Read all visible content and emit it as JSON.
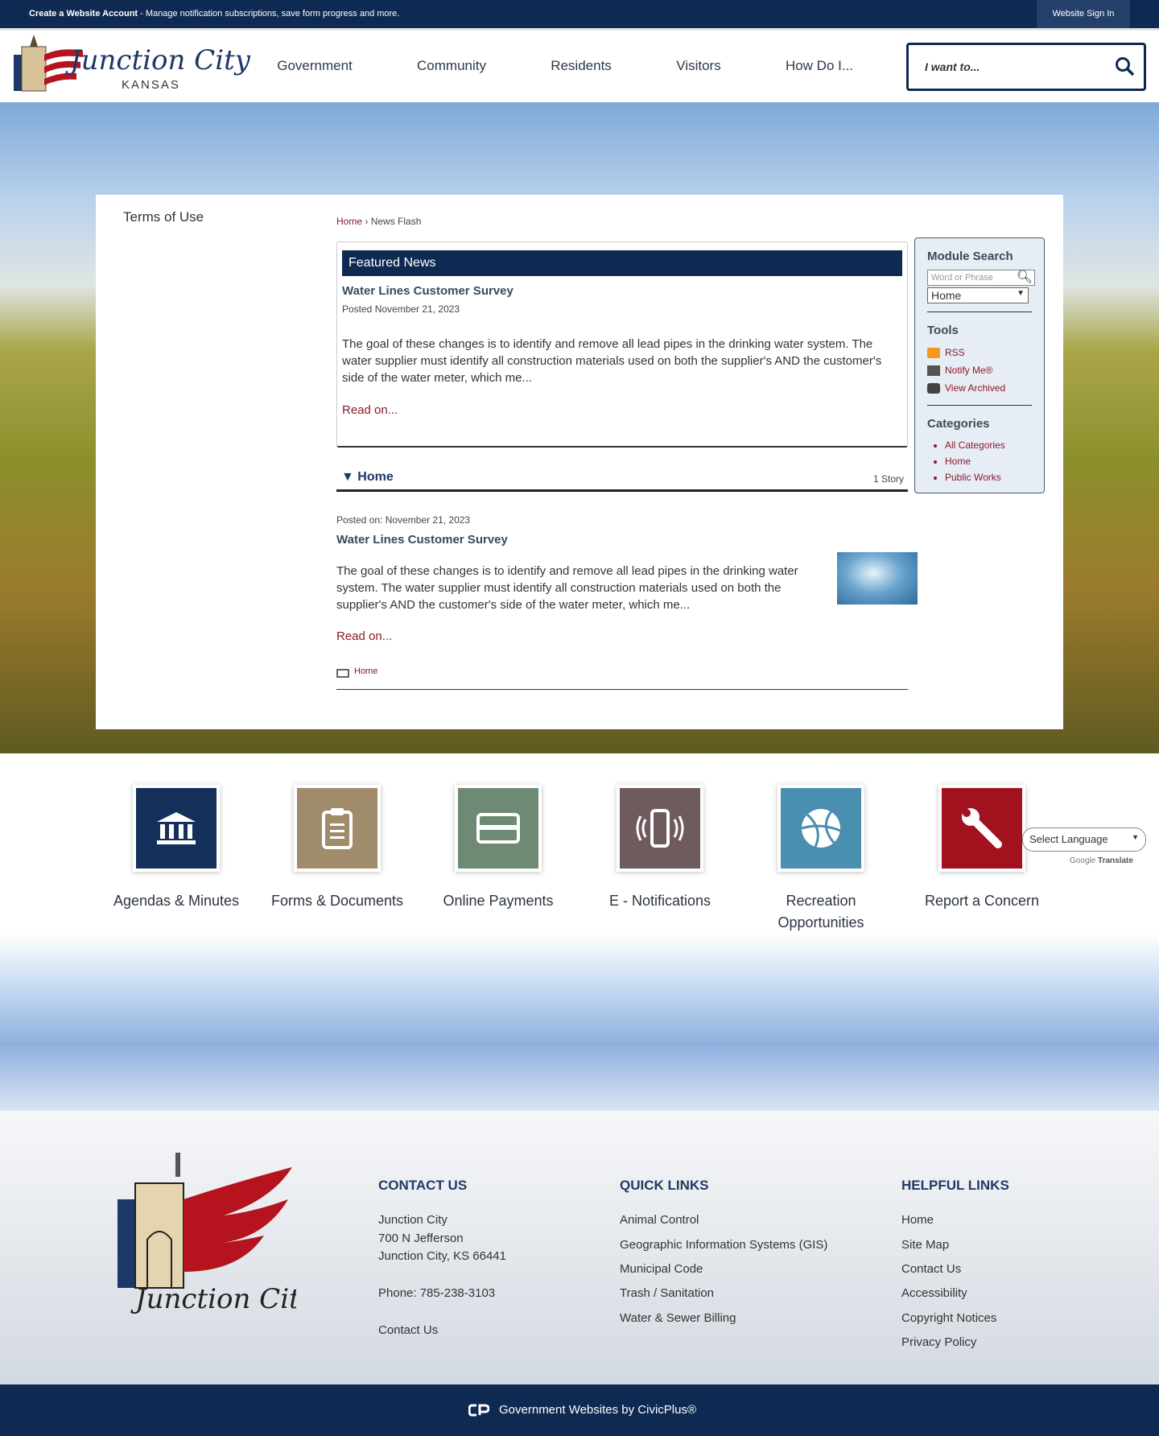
{
  "topbar": {
    "create_account": "Create a Website Account",
    "message": " - Manage notification subscriptions, save form progress and more.",
    "sign_in": "Website Sign In"
  },
  "logo": {
    "name": "Junction City",
    "state": "KANSAS"
  },
  "nav": [
    "Government",
    "Community",
    "Residents",
    "Visitors",
    "How Do I..."
  ],
  "search": {
    "placeholder": "I want to..."
  },
  "left": {
    "terms": "Terms of Use"
  },
  "breadcrumb": {
    "home": "Home",
    "sep": "›",
    "current": "News Flash"
  },
  "featured": {
    "header": "Featured News",
    "title": "Water Lines Customer Survey",
    "posted": "Posted November 21, 2023",
    "body": "The goal of these changes is to identify and remove all lead pipes in the drinking water system. The water supplier must identify all construction materials used on both the supplier's AND the customer's side of the water meter, which me...",
    "read_on": "Read on..."
  },
  "category": {
    "name": "▼ Home",
    "count": "1 Story",
    "posted": "Posted on: November 21, 2023",
    "title": "Water Lines Customer Survey",
    "body": "The goal of these changes is to identify and remove all lead pipes in the drinking water system. The water supplier must identify all construction materials used on both the supplier's AND the customer's side of the water meter, which me...",
    "read_on": "Read on...",
    "tag": "Home"
  },
  "sidebar": {
    "module_search": "Module Search",
    "search_placeholder": "Word or Phrase",
    "select_value": "Home",
    "tools": "Tools",
    "rss": "RSS",
    "notify": "Notify Me®",
    "archived": "View Archived",
    "categories": "Categories",
    "category_items": [
      "All Categories",
      "Home",
      "Public Works"
    ]
  },
  "quick_links": [
    {
      "label": "Agendas & Minutes",
      "color": "#14305a",
      "icon": "government-building-icon"
    },
    {
      "label": "Forms & Documents",
      "color": "#a08b6a",
      "icon": "clipboard-icon"
    },
    {
      "label": "Online Payments",
      "color": "#6f8a74",
      "icon": "credit-card-icon"
    },
    {
      "label": "E - Notifications",
      "color": "#6f5a5e",
      "icon": "phone-vibrate-icon"
    },
    {
      "label": "Recreation Opportunities",
      "color": "#4a8fb0",
      "icon": "basketball-icon"
    },
    {
      "label": "Report a Concern",
      "color": "#a1111e",
      "icon": "wrench-icon"
    }
  ],
  "translate": {
    "select": "Select Language",
    "powered": "Google",
    "translate": "Translate"
  },
  "footer": {
    "contact": {
      "heading": "CONTACT US",
      "name": "Junction City",
      "address1": "700 N Jefferson",
      "address2": "Junction City, KS 66441",
      "phone": "Phone: 785-238-3103",
      "contact": "Contact Us"
    },
    "quick": {
      "heading": "QUICK LINKS",
      "items": [
        "Animal Control",
        "Geographic Information Systems (GIS)",
        "Municipal Code",
        "Trash / Sanitation",
        "Water & Sewer Billing"
      ]
    },
    "helpful": {
      "heading": "HELPFUL LINKS",
      "items": [
        "Home",
        "Site Map",
        "Contact Us",
        "Accessibility",
        "Copyright Notices",
        "Privacy Policy"
      ]
    }
  },
  "bottom": {
    "text": "Government Websites by CivicPlus®"
  }
}
